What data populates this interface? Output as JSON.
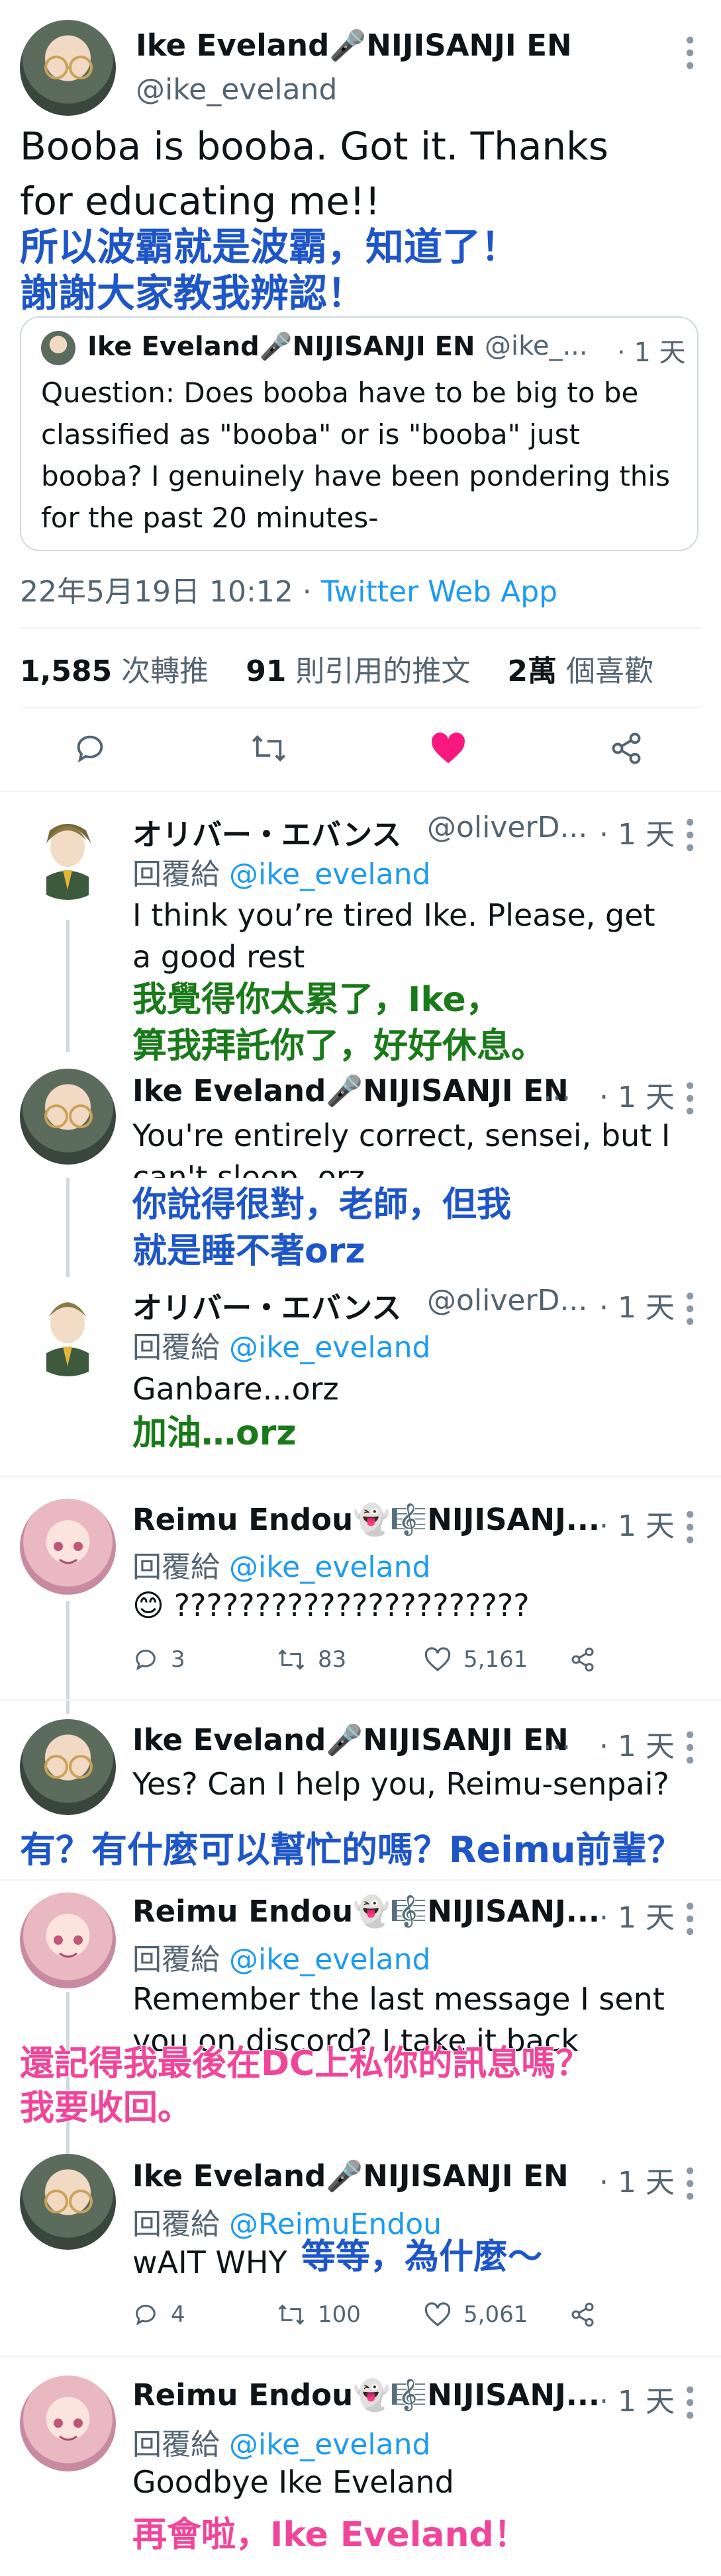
{
  "main_tweet": {
    "name": "Ike Eveland🎤NIJISANJI EN",
    "handle": "@ike_eveland",
    "text_line1": "Booba is booba. Got it. Thanks",
    "text_line2": "for educating me!!",
    "translation_line1": "所以波霸就是波霸，知道了！",
    "translation_line2": "謝謝大家教我辨認！",
    "quoted": {
      "name": "Ike Eveland🎤NIJISANJI EN",
      "handle": "@ike_...",
      "time": "· 1 天",
      "text": "Question: Does booba have to be big to be classified as \"booba\" or is \"booba\" just booba? I genuinely have been pondering this for the past 20 minutes-"
    },
    "timestamp": "22年5月19日 10:12 · ",
    "source": "Twitter Web App",
    "stats": {
      "retweets_num": "1,585",
      "retweets_label": " 次轉推",
      "quotes_num": "91",
      "quotes_label": " 則引用的推文",
      "likes_num": "2萬",
      "likes_label": " 個喜歡"
    }
  },
  "replies": [
    {
      "name": "オリバー・エバンス",
      "handle": "@oliverD...",
      "time": "· 1 天",
      "reply_prefix": "回覆給 ",
      "reply_to": "@ike_eveland",
      "text": "I think you’re tired Ike. Please, get a good rest",
      "translation_line1": "我覺得你太累了，Ike，",
      "translation_line2": "算我拜託你了，好好休息。"
    },
    {
      "name": "Ike Eveland🎤NIJISANJI EN",
      "handle": "...",
      "time": "· 1 天",
      "text": "You're entirely correct, sensei, but I can't sleep. orz",
      "translation_line1": "你說得很對，老師，但我",
      "translation_line2": "就是睡不著orz"
    },
    {
      "name": "オリバー・エバンス",
      "handle": "@oliverD...",
      "time": "· 1 天",
      "reply_prefix": "回覆給 ",
      "reply_to": "@ike_eveland",
      "text": "Ganbare...orz",
      "translation_line1": "加油…orz"
    },
    {
      "name": "Reimu Endou👻🎼NIJISANJ...",
      "time": "· 1 天",
      "reply_prefix": "回覆給 ",
      "reply_to": "@ike_eveland",
      "text": "😊 ??????????????????????",
      "actions": {
        "replies": "3",
        "retweets": "83",
        "likes": "5,161"
      }
    },
    {
      "name": "Ike Eveland🎤NIJISANJI EN",
      "handle": "...",
      "time": "· 1 天",
      "text": "Yes? Can I help you, Reimu-senpai?",
      "translation_line1": "有？有什麼可以幫忙的嗎？Reimu前輩？"
    },
    {
      "name": "Reimu Endou👻🎼NIJISANJ...",
      "time": "· 1 天",
      "reply_prefix": "回覆給 ",
      "reply_to": "@ike_eveland",
      "text": "Remember the last message I sent you on discord? I take it back",
      "translation_line1": "還記得我最後在DC上私你的訊息嗎？",
      "translation_line2": "我要收回。"
    },
    {
      "name": "Ike Eveland🎤NIJISANJI EN",
      "time": "· 1 天",
      "reply_prefix": "回覆給 ",
      "reply_to": "@ReimuEndou",
      "text": "wAIT WHY",
      "translation_line1": "等等，為什麼～",
      "actions": {
        "replies": "4",
        "retweets": "100",
        "likes": "5,061"
      }
    },
    {
      "name": "Reimu Endou👻🎼NIJISANJ...",
      "time": "· 1 天",
      "reply_prefix": "回覆給 ",
      "reply_to": "@ike_eveland",
      "text": "Goodbye Ike Eveland",
      "translation_line1": "再會啦，Ike Eveland！"
    }
  ],
  "colors": {
    "link": "#1d9bf0",
    "like_active": "#f91880",
    "translation_blue": "#1e56c8",
    "translation_green": "#1a7a1a",
    "translation_pink": "#f0469a"
  }
}
